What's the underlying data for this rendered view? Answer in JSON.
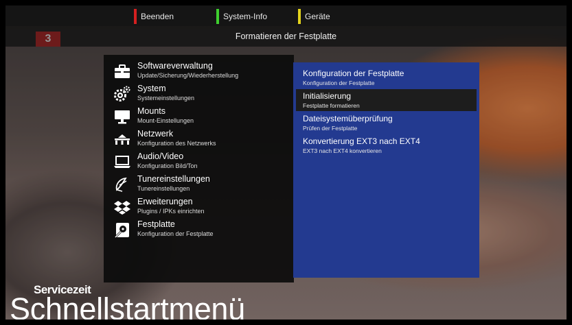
{
  "top_buttons": [
    {
      "label": "Beenden",
      "color": "#d42020"
    },
    {
      "label": "System-Info",
      "color": "#3fcf2f"
    },
    {
      "label": "Geräte",
      "color": "#e3d31c"
    }
  ],
  "screen_title": "Formatieren der Festplatte",
  "channel_logo": {
    "number": "3"
  },
  "menu": [
    {
      "title": "Softwareverwaltung",
      "subtitle": "Update/Sicherung/Wiederherstellung",
      "icon": "toolbox-icon"
    },
    {
      "title": "System",
      "subtitle": "Systemeinstellungen",
      "icon": "gears-icon"
    },
    {
      "title": "Mounts",
      "subtitle": "Mount-Einstellungen",
      "icon": "monitor-stand-icon"
    },
    {
      "title": "Netzwerk",
      "subtitle": "Konfiguration des Netzwerks",
      "icon": "network-icon"
    },
    {
      "title": "Audio/Video",
      "subtitle": "Konfiguration Bild/Ton",
      "icon": "laptop-icon"
    },
    {
      "title": "Tunereinstellungen",
      "subtitle": "Tunereinstellungen",
      "icon": "satellite-dish-icon"
    },
    {
      "title": "Erweiterungen",
      "subtitle": "Plugins / IPKs einrichten",
      "icon": "dropbox-icon"
    },
    {
      "title": "Festplatte",
      "subtitle": "Konfiguration der Festplatte",
      "icon": "hdd-wrench-icon"
    }
  ],
  "submenu": [
    {
      "title": "Konfiguration der Festplatte",
      "subtitle": "Konfiguration der Festplatte",
      "selected": false
    },
    {
      "title": "Initialisierung",
      "subtitle": "Festplatte formatieren",
      "selected": true
    },
    {
      "title": "Dateisystemüberprüfung",
      "subtitle": "Prüfen der Festplatte",
      "selected": false
    },
    {
      "title": "Konvertierung EXT3 nach EXT4",
      "subtitle": "EXT3 nach EXT4 konvertieren",
      "selected": false
    }
  ],
  "branding": {
    "line1": "Servicezeit",
    "line2": "Schnellstartmenü"
  },
  "colors": {
    "submenu_bg": "#233a90",
    "selected_bg": "#1d1d1d"
  }
}
